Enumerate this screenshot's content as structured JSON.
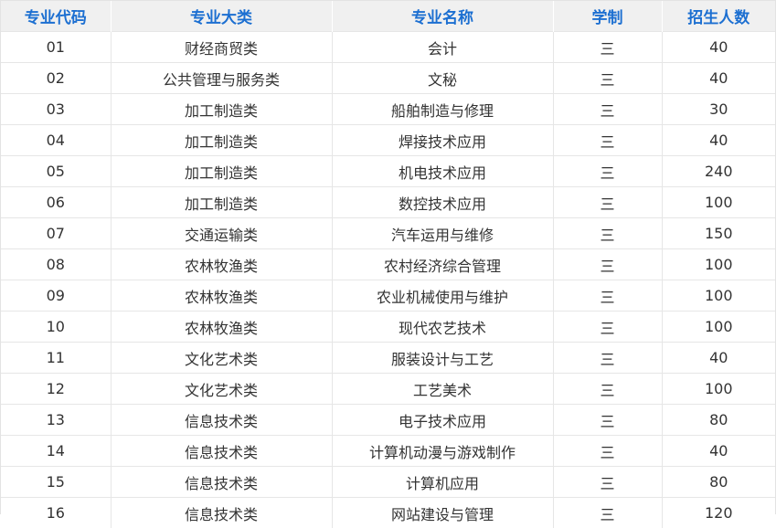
{
  "table": {
    "headers": [
      "专业代码",
      "专业大类",
      "专业名称",
      "学制",
      "招生人数"
    ],
    "rows": [
      [
        "01",
        "财经商贸类",
        "会计",
        "三",
        "40"
      ],
      [
        "02",
        "公共管理与服务类",
        "文秘",
        "三",
        "40"
      ],
      [
        "03",
        "加工制造类",
        "船舶制造与修理",
        "三",
        "30"
      ],
      [
        "04",
        "加工制造类",
        "焊接技术应用",
        "三",
        "40"
      ],
      [
        "05",
        "加工制造类",
        "机电技术应用",
        "三",
        "240"
      ],
      [
        "06",
        "加工制造类",
        "数控技术应用",
        "三",
        "100"
      ],
      [
        "07",
        "交通运输类",
        "汽车运用与维修",
        "三",
        "150"
      ],
      [
        "08",
        "农林牧渔类",
        "农村经济综合管理",
        "三",
        "100"
      ],
      [
        "09",
        "农林牧渔类",
        "农业机械使用与维护",
        "三",
        "100"
      ],
      [
        "10",
        "农林牧渔类",
        "现代农艺技术",
        "三",
        "100"
      ],
      [
        "11",
        "文化艺术类",
        "服装设计与工艺",
        "三",
        "40"
      ],
      [
        "12",
        "文化艺术类",
        "工艺美术",
        "三",
        "100"
      ],
      [
        "13",
        "信息技术类",
        "电子技术应用",
        "三",
        "80"
      ],
      [
        "14",
        "信息技术类",
        "计算机动漫与游戏制作",
        "三",
        "40"
      ],
      [
        "15",
        "信息技术类",
        "计算机应用",
        "三",
        "80"
      ],
      [
        "16",
        "信息技术类",
        "网站建设与管理",
        "三",
        "120"
      ]
    ]
  },
  "colors": {
    "header_text": "#1c6fd1",
    "header_bg": "#f0f0f0",
    "body_text": "#333333",
    "grid": "#e6e6e6"
  }
}
